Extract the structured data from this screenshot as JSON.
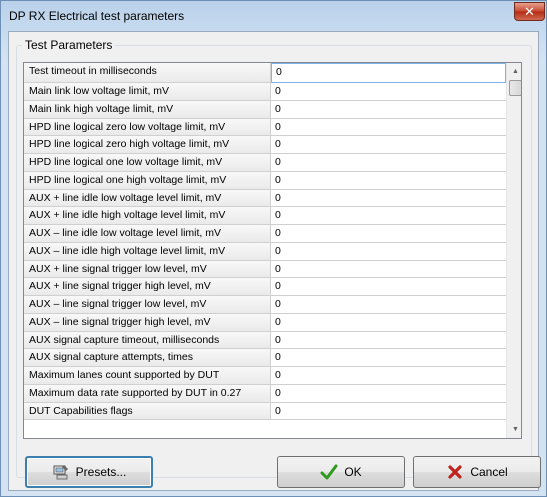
{
  "window": {
    "title": "DP RX Electrical test parameters",
    "close_label": "✕"
  },
  "group": {
    "legend": "Test Parameters"
  },
  "params": [
    {
      "name": "Test timeout in milliseconds",
      "value": "0"
    },
    {
      "name": "Main link low voltage limit, mV",
      "value": "0"
    },
    {
      "name": "Main link high voltage limit, mV",
      "value": "0"
    },
    {
      "name": "HPD line logical zero low voltage limit, mV",
      "value": "0"
    },
    {
      "name": "HPD line logical zero high voltage limit, mV",
      "value": "0"
    },
    {
      "name": "HPD line logical one low voltage limit, mV",
      "value": "0"
    },
    {
      "name": "HPD line logical one high voltage limit, mV",
      "value": "0"
    },
    {
      "name": "AUX + line idle low voltage level limit, mV",
      "value": "0"
    },
    {
      "name": "AUX + line idle high voltage level limit, mV",
      "value": "0"
    },
    {
      "name": "AUX – line idle low voltage level limit, mV",
      "value": "0"
    },
    {
      "name": "AUX – line idle high voltage level limit, mV",
      "value": "0"
    },
    {
      "name": "AUX + line signal trigger low level, mV",
      "value": "0"
    },
    {
      "name": "AUX + line signal trigger high level, mV",
      "value": "0"
    },
    {
      "name": "AUX – line signal trigger low level, mV",
      "value": "0"
    },
    {
      "name": "AUX – line signal trigger high level, mV",
      "value": "0"
    },
    {
      "name": "AUX signal capture timeout, milliseconds",
      "value": "0"
    },
    {
      "name": "AUX signal capture attempts, times",
      "value": "0"
    },
    {
      "name": "Maximum lanes count supported by DUT",
      "value": "0"
    },
    {
      "name": "Maximum data rate supported by DUT in 0.27",
      "value": "0"
    },
    {
      "name": "DUT Capabilities flags",
      "value": "0"
    }
  ],
  "buttons": {
    "presets": "Presets...",
    "ok": "OK",
    "cancel": "Cancel"
  },
  "icons": {
    "presets": "presets-icon",
    "ok": "checkmark-icon",
    "cancel": "x-mark-icon"
  },
  "colors": {
    "ok_check": "#2f9a1e",
    "cancel_x": "#c0231b",
    "title_bar": "#c7dbef"
  }
}
